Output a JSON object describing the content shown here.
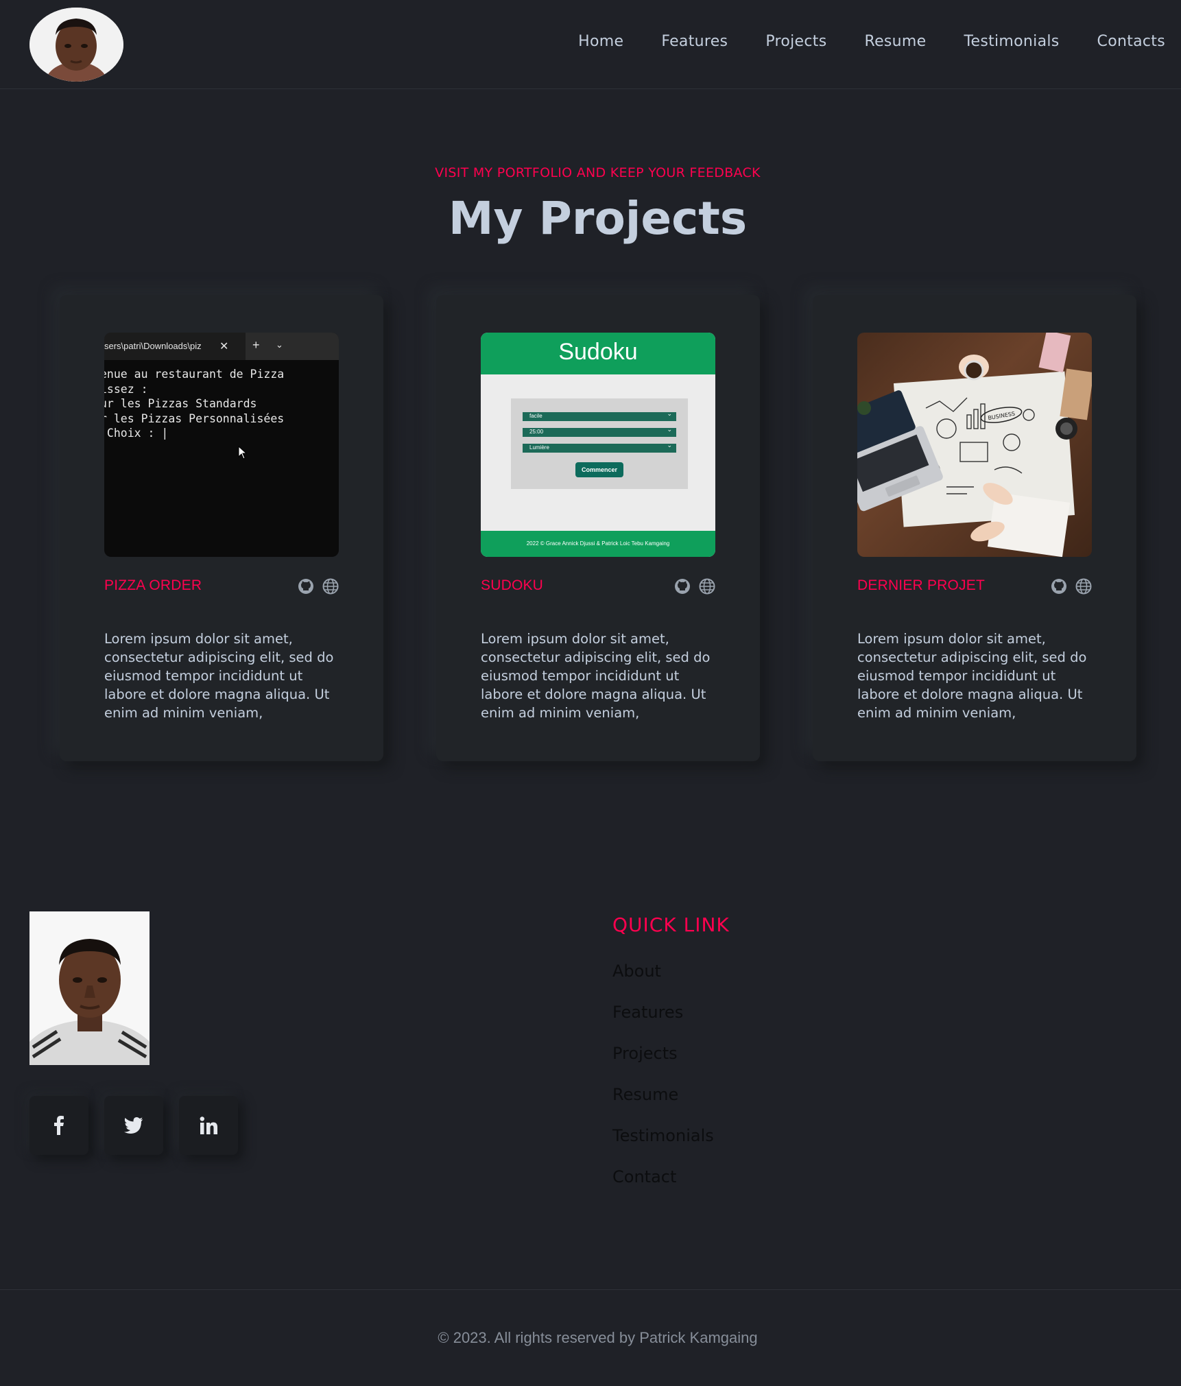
{
  "nav": {
    "items": [
      {
        "label": "Home"
      },
      {
        "label": "Features"
      },
      {
        "label": "Projects"
      },
      {
        "label": "Resume"
      },
      {
        "label": "Testimonials"
      },
      {
        "label": "Contacts"
      }
    ]
  },
  "section": {
    "subtitle": "VISIT MY PORTFOLIO AND KEEP YOUR FEEDBACK",
    "title": "My Projects"
  },
  "projects": [
    {
      "title": "PIZZA ORDER",
      "description": "Lorem ipsum dolor sit amet, consectetur adipiscing elit, sed do eiusmod tempor incididunt ut labore et dolore magna aliqua. Ut enim ad minim veniam,",
      "thumb": {
        "tab_label": "sers\\patri\\Downloads\\piz",
        "lines": [
          "enue au restaurant de Pizza",
          "issez :",
          "ur les Pizzas Standards",
          "r les Pizzas Personnalisées",
          " Choix : |"
        ]
      }
    },
    {
      "title": "SUDOKU",
      "description": "Lorem ipsum dolor sit amet, consectetur adipiscing elit, sed do eiusmod tempor incididunt ut labore et dolore magna aliqua. Ut enim ad minim veniam,",
      "thumb": {
        "heading": "Sudoku",
        "select_1": "facile",
        "select_2": "25:00",
        "select_3": "Lumière",
        "button": "Commencer",
        "footer": "2022 © Grace Annick Djussi & Patrick Loic Tebu Kamgaing"
      }
    },
    {
      "title": "DERNIER PROJET",
      "description": "Lorem ipsum dolor sit amet, consectetur adipiscing elit, sed do eiusmod tempor incididunt ut labore et dolore magna aliqua. Ut enim ad minim veniam,",
      "thumb": {
        "sticker": "BUSINESS"
      }
    }
  ],
  "icons": {
    "github": "github-icon",
    "globe": "globe-icon",
    "facebook": "facebook-icon",
    "twitter": "twitter-icon",
    "linkedin": "linkedin-icon"
  },
  "footer": {
    "quick_title": "QUICK LINK",
    "links": [
      {
        "label": "About"
      },
      {
        "label": "Features"
      },
      {
        "label": "Projects"
      },
      {
        "label": "Resume"
      },
      {
        "label": "Testimonials"
      },
      {
        "label": "Contact"
      }
    ],
    "copyright": "© 2023. All rights reserved by Patrick Kamgaing"
  },
  "colors": {
    "accent": "#ff014f",
    "background": "#1f2127",
    "text": "#c4cfde"
  }
}
